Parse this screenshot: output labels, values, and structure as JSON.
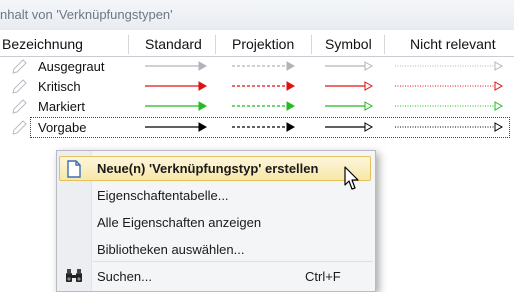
{
  "window": {
    "title": "nhalt von 'Verknüpfungstypen'"
  },
  "columns": [
    "Bezeichnung",
    "Standard",
    "Projektion",
    "Symbol",
    "Nicht relevant"
  ],
  "rows": [
    {
      "label": "Ausgegraut",
      "color": "#b0b4ba"
    },
    {
      "label": "Kritisch",
      "color": "#e01010"
    },
    {
      "label": "Markiert",
      "color": "#22bb22"
    },
    {
      "label": "Vorgabe",
      "color": "#000000"
    }
  ],
  "context_menu": {
    "items": [
      {
        "label": "Neue(n) 'Verknüpfungstyp' erstellen",
        "icon": "new-document-icon",
        "highlighted": true
      },
      {
        "label": "Eigenschaftentabelle..."
      },
      {
        "label": "Alle Eigenschaften anzeigen"
      },
      {
        "label": "Bibliotheken auswählen..."
      },
      {
        "label": "Suchen...",
        "icon": "binoculars-icon",
        "shortcut": "Ctrl+F"
      }
    ]
  }
}
